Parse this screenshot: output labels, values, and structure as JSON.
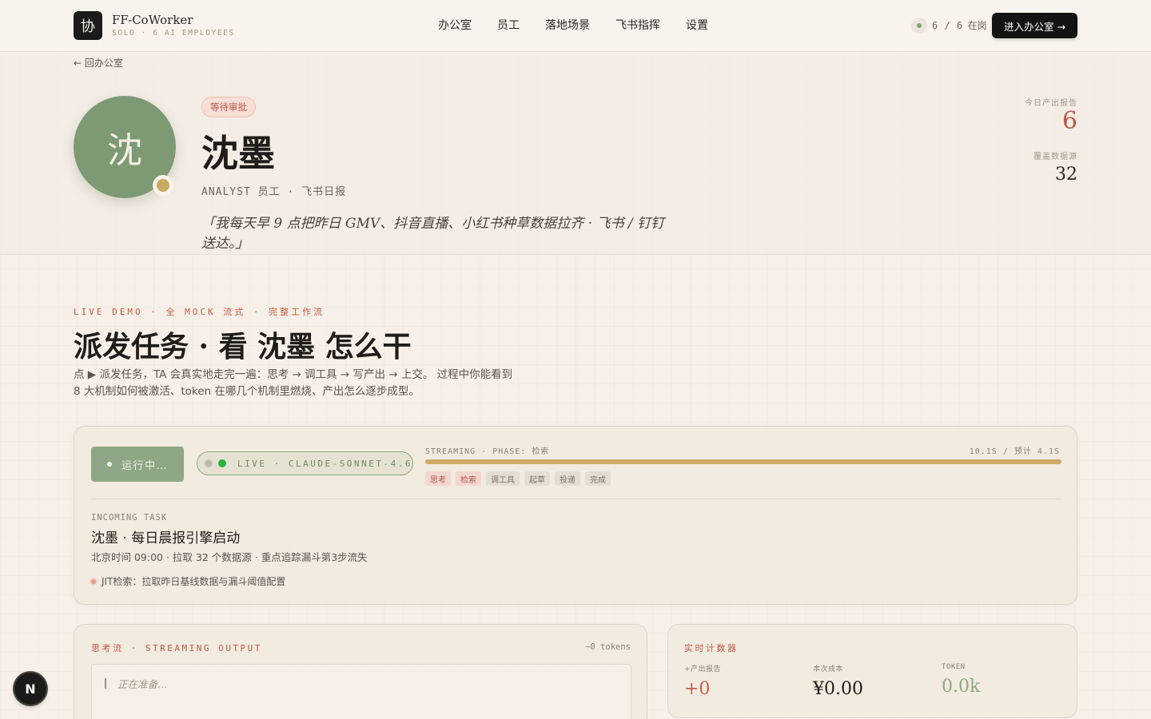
{
  "brand": {
    "logo_glyph": "协",
    "name": "FF-CoWorker",
    "subtitle": "SOLO · 6 AI EMPLOYEES"
  },
  "nav": {
    "items": [
      "办公室",
      "员工",
      "落地场景",
      "飞书指挥",
      "设置"
    ]
  },
  "status": {
    "online_count": "6 / 6",
    "online_label": "在岗",
    "dot_color": "#7fa67b"
  },
  "header": {
    "enter_button": "进入办公室 →"
  },
  "back_link": "← 回办公室",
  "employee": {
    "avatar_glyph": "沈",
    "avatar_color": "#7e9a74",
    "badge": "等待审批",
    "name": "沈墨",
    "role": "ANALYST 员工 · 飞书日报",
    "quote": "「我每天早 9 点把昨日 GMV、抖音直播、小红书种草数据拉齐 · 飞书 / 钉钉送达。」"
  },
  "stats": {
    "reports_today_label": "今日产出报告",
    "reports_today_value": "6",
    "data_sources_label": "覆盖数据源",
    "data_sources_value": "32"
  },
  "demo": {
    "eyebrow": "LIVE DEMO · 全 MOCK 流式 · 完整工作流",
    "title": "派发任务 · 看 沈墨 怎么干",
    "desc_line1": "点 ▶ 派发任务，TA 会真实地走完一遍：思考 → 调工具 → 写产出 → 上交。 过程中你能看到",
    "desc_line2": "8 大机制如何被激活、token 在哪几个机制里燃烧、产出怎么逐步成型。"
  },
  "run": {
    "button": "运行中…",
    "live_label": "LIVE · CLAUDE-SONNET-4.6",
    "stream_label": "STREAMING · PHASE: 检索",
    "time_label": "10.1S / 预计 4.1S",
    "progress": 1.0,
    "phases": [
      {
        "label": "思考",
        "done": true
      },
      {
        "label": "检索",
        "done": true
      },
      {
        "label": "调工具",
        "done": false
      },
      {
        "label": "起草",
        "done": false
      },
      {
        "label": "投递",
        "done": false
      },
      {
        "label": "完成",
        "done": false
      }
    ],
    "incoming_label": "INCOMING TASK",
    "task_title": "沈墨 · 每日晨报引擎启动",
    "task_meta": "北京时间 09:00 · 拉取 32 个数据源 · 重点追踪漏斗第3步流失",
    "jit": "JIT检索：拉取昨日基线数据与漏斗阈值配置"
  },
  "thinking": {
    "header": "思考流 · STREAMING OUTPUT",
    "tokens": "~0 tokens",
    "placeholder": "正在准备…"
  },
  "counters": {
    "header": "实时计数器",
    "reports_label": "+产出报告",
    "reports_value": "+0",
    "cost_label": "本次成本",
    "cost_value": "¥0.00",
    "token_label": "TOKEN",
    "token_value": "0.0k"
  },
  "corner_badge": "N"
}
